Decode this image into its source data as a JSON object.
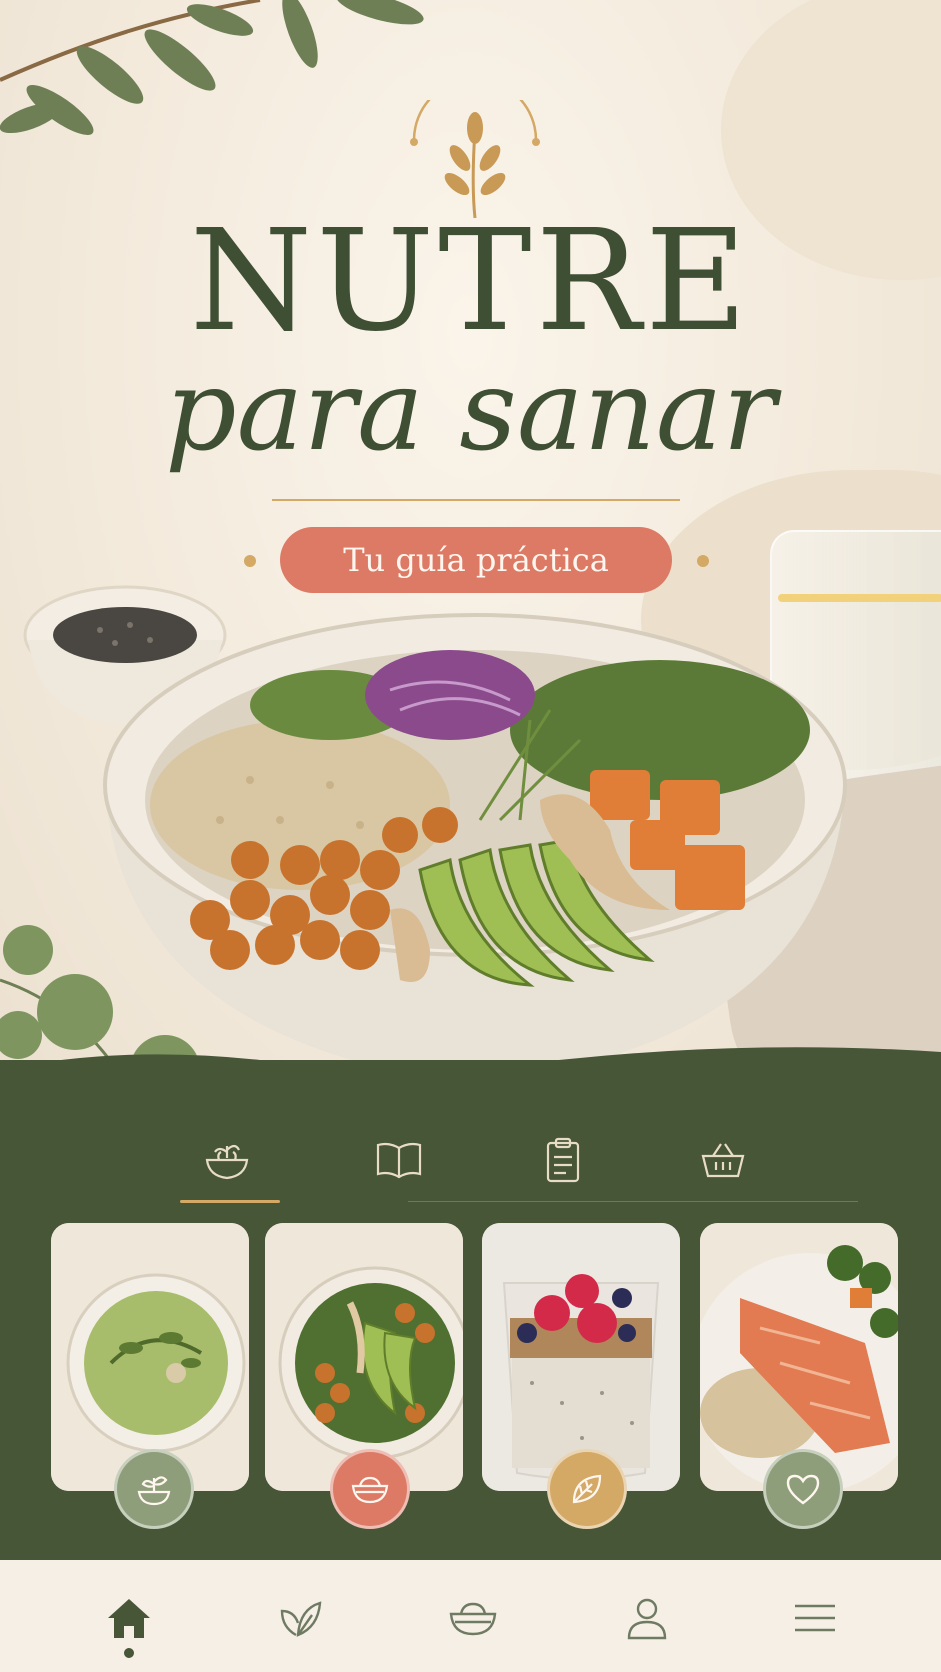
{
  "brand": {
    "title": "NUTRE",
    "subtitle": "para sanar",
    "tagline": "Tu guía práctica"
  },
  "colors": {
    "primary_green": "#465637",
    "title_green": "#3f4f33",
    "accent_gold": "#d4a865",
    "accent_coral": "#dc7a66",
    "cream": "#f5ede1",
    "sage": "#8e9e7a"
  },
  "tabs": [
    {
      "icon": "bowl-sprout-icon",
      "active": true
    },
    {
      "icon": "open-book-icon",
      "active": false
    },
    {
      "icon": "clipboard-icon",
      "active": false
    },
    {
      "icon": "basket-icon",
      "active": false
    }
  ],
  "cards": [
    {
      "image": "green-soup",
      "badge_icon": "sprout-icon",
      "badge_color": "#8e9e7a"
    },
    {
      "image": "kale-chickpea-bowl",
      "badge_icon": "bowl-icon",
      "badge_color": "#dc7a66"
    },
    {
      "image": "chia-berry-parfait",
      "badge_icon": "leaf-icon",
      "badge_color": "#d4a865"
    },
    {
      "image": "salmon-quinoa",
      "badge_icon": "heart-icon",
      "badge_color": "#8e9e7a"
    }
  ],
  "bottom_nav": [
    {
      "icon": "home-icon",
      "active": true
    },
    {
      "icon": "leaf-icon",
      "active": false
    },
    {
      "icon": "bowl-icon",
      "active": false
    },
    {
      "icon": "user-icon",
      "active": false
    },
    {
      "icon": "menu-icon",
      "active": false
    }
  ]
}
